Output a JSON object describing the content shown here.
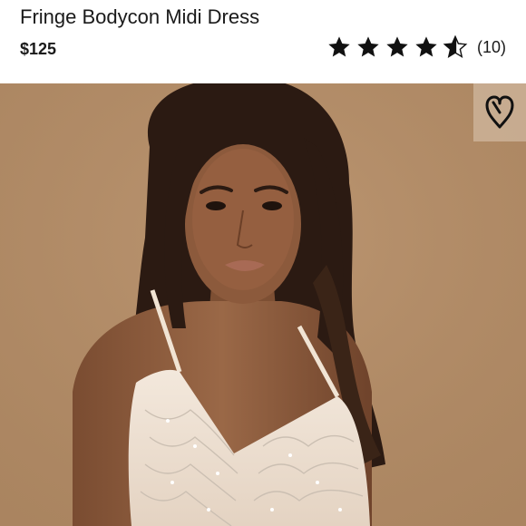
{
  "product": {
    "title_line1": "Fringe Bodycon Midi Dress",
    "price": "$125",
    "rating": 4.5,
    "rating_max": 5,
    "review_count": "(10)"
  },
  "image": {
    "background_color": "#b38d69",
    "skin_color": "#8a5a3a",
    "hair_color": "#2b1a12",
    "dress_color": "#efe2d3"
  },
  "icons": {
    "favorite": "heart-outline-icon",
    "star": "star-icon"
  }
}
